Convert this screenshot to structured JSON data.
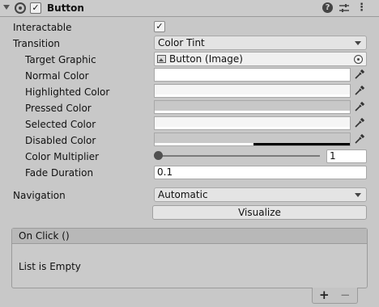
{
  "header": {
    "title": "Button",
    "enabled_check": "✓",
    "help_glyph": "?",
    "menu_glyph": "⋮"
  },
  "props": {
    "interactable": {
      "label": "Interactable",
      "check": "✓"
    },
    "transition": {
      "label": "Transition",
      "value": "Color Tint"
    },
    "target_graphic": {
      "label": "Target Graphic",
      "value": "Button (Image)"
    },
    "normal_color": {
      "label": "Normal Color",
      "color": "#ffffff"
    },
    "highlighted_color": {
      "label": "Highlighted Color",
      "color": "#f5f5f5"
    },
    "pressed_color": {
      "label": "Pressed Color",
      "color": "#c8c8c8"
    },
    "selected_color": {
      "label": "Selected Color",
      "color": "#f5f5f5"
    },
    "disabled_color": {
      "label": "Disabled Color",
      "color": "#c8c8c8"
    },
    "color_multiplier": {
      "label": "Color Multiplier",
      "value": "1",
      "level": 0.0
    },
    "fade_duration": {
      "label": "Fade Duration",
      "value": "0.1"
    },
    "navigation": {
      "label": "Navigation",
      "value": "Automatic"
    },
    "visualize": {
      "label": "Visualize"
    }
  },
  "on_click": {
    "header": "On Click ()",
    "empty_text": "List is Empty",
    "add_glyph": "+",
    "remove_glyph": "−"
  }
}
